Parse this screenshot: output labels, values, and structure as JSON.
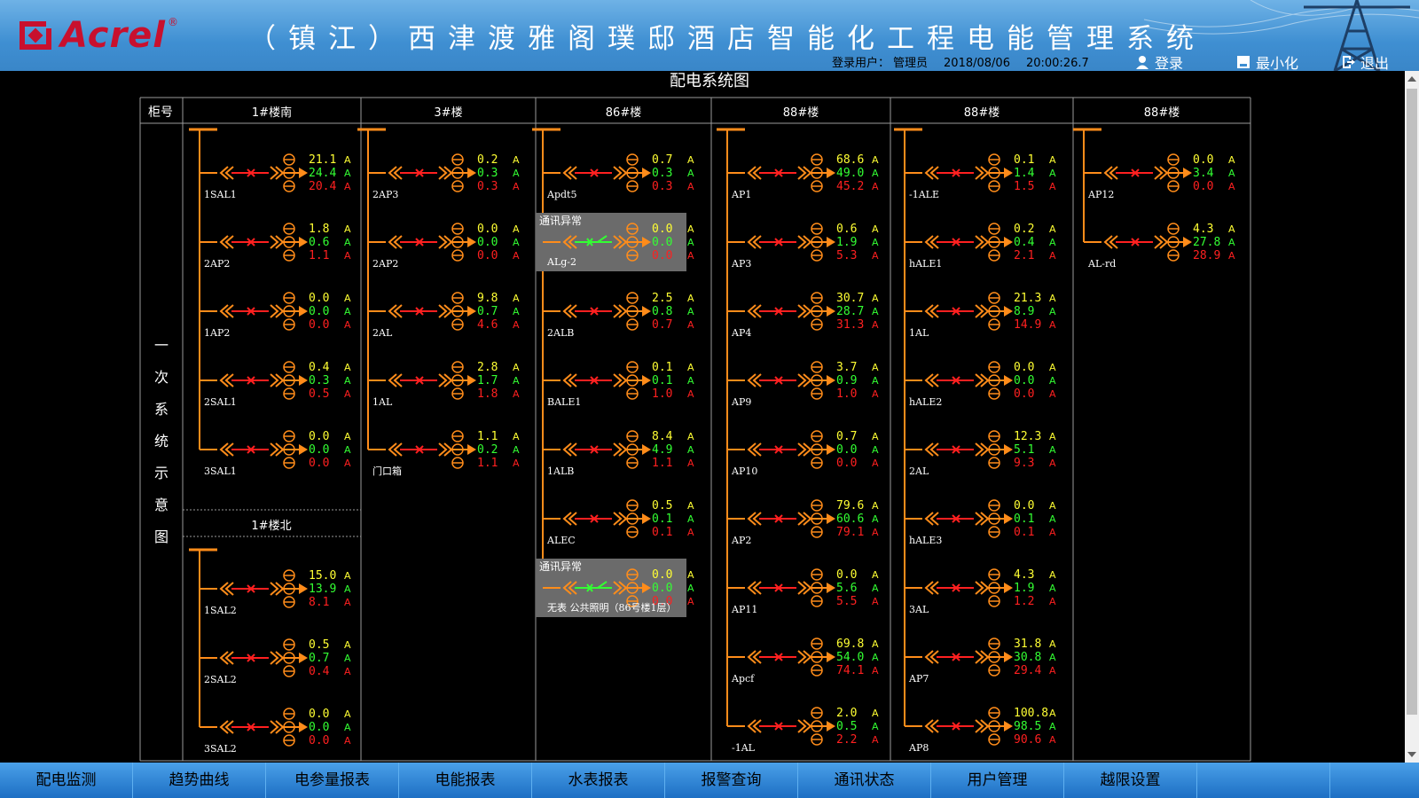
{
  "header": {
    "brand": "Acrel",
    "registered": "®",
    "title": "（镇江）西津渡雅阁璞邸酒店智能化工程电能管理系统",
    "login_label": "登录用户：",
    "user": "管理员",
    "date": "2018/08/06",
    "time": "20:00:26.7",
    "buttons": {
      "login": "登录",
      "minimize": "最小化",
      "exit": "退出"
    }
  },
  "diagram": {
    "title": "配电系统图",
    "row_header": "柜号",
    "side_label": "一次系统示意图",
    "unit": "A",
    "columns": [
      {
        "name": "1#楼南",
        "feeders": [
          {
            "label": "1SAL1",
            "values": [
              "21.1",
              "24.4",
              "20.4"
            ]
          },
          {
            "label": "2AP2",
            "values": [
              "1.8",
              "0.6",
              "1.1"
            ]
          },
          {
            "label": "1AP2",
            "values": [
              "0.0",
              "0.0",
              "0.0"
            ]
          },
          {
            "label": "2SAL1",
            "values": [
              "0.4",
              "0.3",
              "0.5"
            ]
          },
          {
            "label": "3SAL1",
            "values": [
              "0.0",
              "0.0",
              "0.0"
            ]
          }
        ]
      },
      {
        "name": "3#楼",
        "feeders": [
          {
            "label": "2AP3",
            "values": [
              "0.2",
              "0.3",
              "0.3"
            ]
          },
          {
            "label": "2AP2",
            "values": [
              "0.0",
              "0.0",
              "0.0"
            ]
          },
          {
            "label": "2AL",
            "values": [
              "9.8",
              "0.7",
              "4.6"
            ]
          },
          {
            "label": "1AL",
            "values": [
              "2.8",
              "1.7",
              "1.8"
            ]
          },
          {
            "label": "门口箱",
            "values": [
              "1.1",
              "0.2",
              "1.1"
            ]
          }
        ]
      },
      {
        "name": "86#楼",
        "feeders": [
          {
            "label": "Apdt5",
            "values": [
              "0.7",
              "0.3",
              "0.3"
            ]
          },
          {
            "label": "ALg-2",
            "values": [
              "0.0",
              "0.0",
              "0.0"
            ],
            "fault": "通讯异常"
          },
          {
            "label": "2ALB",
            "values": [
              "2.5",
              "0.8",
              "0.7"
            ]
          },
          {
            "label": "BALE1",
            "values": [
              "0.1",
              "0.1",
              "1.0"
            ]
          },
          {
            "label": "1ALB",
            "values": [
              "8.4",
              "4.9",
              "1.1"
            ]
          },
          {
            "label": "ALEC",
            "values": [
              "0.5",
              "0.1",
              "0.1"
            ]
          },
          {
            "label": "无表 公共照明（86号楼1层）",
            "values": [
              "0.0",
              "0.0",
              "0.0"
            ],
            "fault": "通讯异常"
          }
        ]
      },
      {
        "name": "88#楼",
        "feeders": [
          {
            "label": "AP1",
            "values": [
              "68.6",
              "49.0",
              "45.2"
            ]
          },
          {
            "label": "AP3",
            "values": [
              "0.6",
              "1.9",
              "5.3"
            ]
          },
          {
            "label": "AP4",
            "values": [
              "30.7",
              "28.7",
              "31.3"
            ]
          },
          {
            "label": "AP9",
            "values": [
              "3.7",
              "0.9",
              "1.0"
            ]
          },
          {
            "label": "AP10",
            "values": [
              "0.7",
              "0.0",
              "0.0"
            ]
          },
          {
            "label": "AP2",
            "values": [
              "79.6",
              "60.6",
              "79.1"
            ]
          },
          {
            "label": "AP11",
            "values": [
              "0.0",
              "5.6",
              "5.5"
            ]
          },
          {
            "label": "Apcf",
            "values": [
              "69.8",
              "54.0",
              "74.1"
            ]
          },
          {
            "label": "-1AL",
            "values": [
              "2.0",
              "0.5",
              "2.2"
            ]
          }
        ]
      },
      {
        "name": "88#楼",
        "feeders": [
          {
            "label": "-1ALE",
            "values": [
              "0.1",
              "1.4",
              "1.5"
            ]
          },
          {
            "label": "hALE1",
            "values": [
              "0.2",
              "0.4",
              "2.1"
            ]
          },
          {
            "label": "1AL",
            "values": [
              "21.3",
              "8.9",
              "14.9"
            ]
          },
          {
            "label": "hALE2",
            "values": [
              "0.0",
              "0.0",
              "0.0"
            ]
          },
          {
            "label": "2AL",
            "values": [
              "12.3",
              "5.1",
              "9.3"
            ]
          },
          {
            "label": "hALE3",
            "values": [
              "0.0",
              "0.1",
              "0.1"
            ]
          },
          {
            "label": "3AL",
            "values": [
              "4.3",
              "1.9",
              "1.2"
            ]
          },
          {
            "label": "AP7",
            "values": [
              "31.8",
              "30.8",
              "29.4"
            ]
          },
          {
            "label": "AP8",
            "values": [
              "100.8",
              "98.5",
              "90.6"
            ]
          }
        ]
      },
      {
        "name": "88#楼",
        "feeders": [
          {
            "label": "AP12",
            "values": [
              "0.0",
              "3.4",
              "0.0"
            ]
          },
          {
            "label": "AL-rd",
            "values": [
              "4.3",
              "27.8",
              "28.9"
            ]
          }
        ]
      }
    ],
    "sub_column": {
      "name": "1#楼北",
      "feeders": [
        {
          "label": "1SAL2",
          "values": [
            "15.0",
            "13.9",
            "8.1"
          ]
        },
        {
          "label": "2SAL2",
          "values": [
            "0.5",
            "0.7",
            "0.4"
          ]
        },
        {
          "label": "3SAL2",
          "values": [
            "0.0",
            "0.0",
            "0.0"
          ]
        }
      ]
    }
  },
  "colors": {
    "bus": "#ff8c1a",
    "breaker": "#ff2020",
    "phase_a": "#ffff33",
    "phase_b": "#33ff33",
    "phase_c": "#ff2020",
    "ok_switch": "#33ff33",
    "fault_bg": "#6b6b6b",
    "grid": "#9a9a9a"
  },
  "footer": {
    "tabs": [
      "配电监测",
      "趋势曲线",
      "电参量报表",
      "电能报表",
      "水表报表",
      "报警查询",
      "通讯状态",
      "用户管理",
      "越限设置",
      ""
    ]
  }
}
